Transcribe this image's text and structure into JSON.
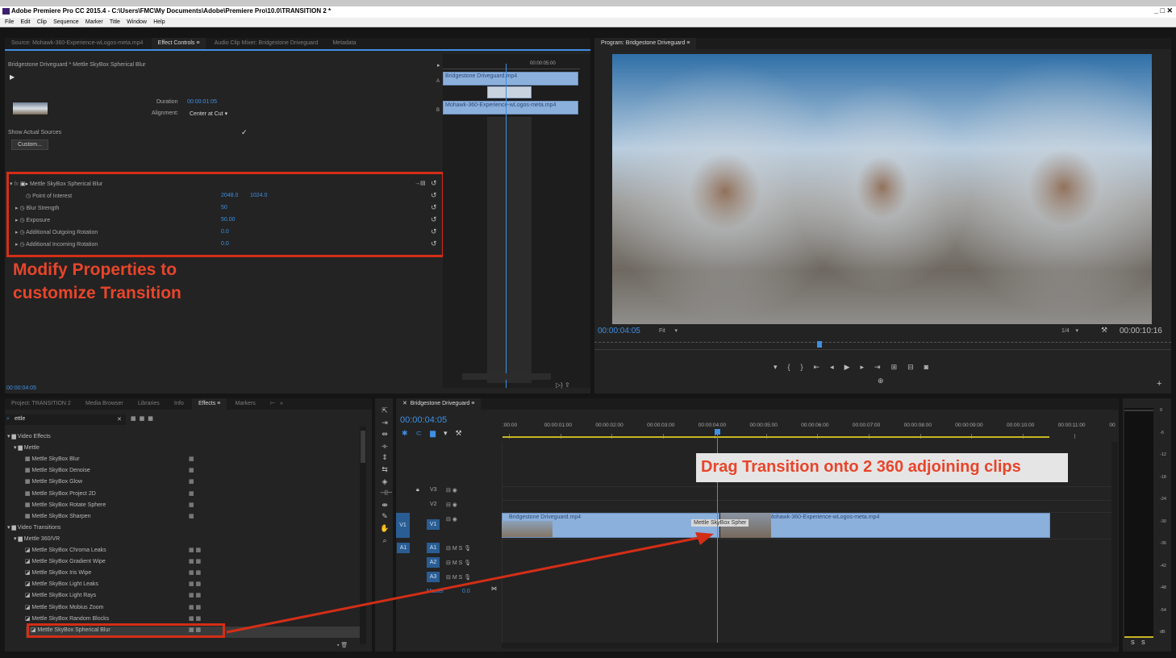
{
  "window": {
    "title": "Adobe Premiere Pro CC 2015.4 - C:\\Users\\FMC\\My Documents\\Adobe\\Premiere Pro\\10.0\\TRANSITION 2 *",
    "controls": "_ □ ✕"
  },
  "menu": [
    "File",
    "Edit",
    "Clip",
    "Sequence",
    "Marker",
    "Title",
    "Window",
    "Help"
  ],
  "source_panel": {
    "tabs": [
      "Source: Mohawk-360-Experience-wLogos-meta.mp4",
      "Effect Controls",
      "Audio Clip Mixer: Bridgestone Driveguard",
      "Metadata"
    ],
    "active_tab": "Effect Controls",
    "header": "Bridgestone Driveguard * Mettle SkyBox Spherical Blur",
    "duration_label": "Duration",
    "duration_value": "00:00:01:05",
    "alignment_label": "Alignment:",
    "alignment_value": "Center at Cut",
    "show_actual_sources": "Show Actual Sources",
    "custom_button": "Custom...",
    "effect_name": "Mettle SkyBox Spherical Blur",
    "properties": [
      {
        "name": "Point of Interest",
        "value": "2048.0",
        "value2": "1024.0"
      },
      {
        "name": "Blur Strength",
        "value": "50",
        "value2": ""
      },
      {
        "name": "Exposure",
        "value": "50.00",
        "value2": ""
      },
      {
        "name": "Additional Outgoing Rotation",
        "value": "0.0",
        "value2": ""
      },
      {
        "name": "Additional Incoming Rotation",
        "value": "0.0",
        "value2": ""
      }
    ],
    "timecode": "00:00:04:05",
    "mini_timeline": {
      "time": "00:00:05:00",
      "track_a": "A",
      "track_b": "B",
      "clip_a": "Bridgestone Driveguard.mp4",
      "clip_b": "Mohawk-360-Experience-wLogos-meta.mp4"
    }
  },
  "annotations": {
    "properties": "Modify Properties to customize Transition",
    "drag": "Drag Transition onto 2 360 adjoining clips"
  },
  "program_monitor": {
    "title": "Program: Bridgestone Driveguard",
    "timecode": "00:00:04:05",
    "fit": "Fit",
    "resolution": "1/4",
    "duration": "00:00:10:16"
  },
  "project_panel": {
    "tabs": [
      "Project: TRANSITION 2",
      "Media Browser",
      "Libraries",
      "Info",
      "Effects",
      "Markers"
    ],
    "active_tab": "Effects",
    "search_value": "ettle",
    "tree": [
      {
        "label": "Video Effects",
        "level": 0,
        "type": "folder"
      },
      {
        "label": "Mettle",
        "level": 1,
        "type": "folder"
      },
      {
        "label": "Mettle SkyBox Blur",
        "level": 2,
        "type": "fx",
        "b2": false
      },
      {
        "label": "Mettle SkyBox Denoise",
        "level": 2,
        "type": "fx",
        "b2": false
      },
      {
        "label": "Mettle SkyBox Glow",
        "level": 2,
        "type": "fx",
        "b2": false
      },
      {
        "label": "Mettle SkyBox Project 2D",
        "level": 2,
        "type": "fx",
        "b2": false
      },
      {
        "label": "Mettle SkyBox Rotate Sphere",
        "level": 2,
        "type": "fx",
        "b2": false
      },
      {
        "label": "Mettle SkyBox Sharpen",
        "level": 2,
        "type": "fx",
        "b2": false
      },
      {
        "label": "Video Transitions",
        "level": 0,
        "type": "folder"
      },
      {
        "label": "Mettle 360/VR",
        "level": 1,
        "type": "folder"
      },
      {
        "label": "Mettle SkyBox Chroma Leaks",
        "level": 2,
        "type": "tr",
        "b2": true
      },
      {
        "label": "Mettle SkyBox Gradient Wipe",
        "level": 2,
        "type": "tr",
        "b2": true
      },
      {
        "label": "Mettle SkyBox Iris Wipe",
        "level": 2,
        "type": "tr",
        "b2": true
      },
      {
        "label": "Mettle SkyBox Light Leaks",
        "level": 2,
        "type": "tr",
        "b2": true
      },
      {
        "label": "Mettle SkyBox Light Rays",
        "level": 2,
        "type": "tr",
        "b2": true
      },
      {
        "label": "Mettle SkyBox Mobius Zoom",
        "level": 2,
        "type": "tr",
        "b2": true
      },
      {
        "label": "Mettle SkyBox Random Blocks",
        "level": 2,
        "type": "tr",
        "b2": true
      },
      {
        "label": "Mettle SkyBox Spherical Blur",
        "level": 2,
        "type": "tr",
        "b2": true
      }
    ]
  },
  "timeline": {
    "title": "Bridgestone Driveguard",
    "timecode": "00:00:04:05",
    "ruler": [
      ":00:00",
      "00:00:01:00",
      "00:00:02:00",
      "00:00:03:00",
      "00:00:04:00",
      "00:00:05:00",
      "00:00:06:00",
      "00:00:07:00",
      "00:00:08:00",
      "00:00:09:00",
      "00:00:10:00",
      "00:00:11:00",
      "00"
    ],
    "tracks": {
      "v3": "V3",
      "v2": "V2",
      "v1": "V1",
      "a1": "A1",
      "a2": "A2",
      "a3": "A3",
      "master": "Master",
      "master_value": "0.0",
      "mute": "M",
      "solo": "S"
    },
    "clip1": "Bridgestone Driveguard.mp4",
    "clip2": "Mohawk-360-Experience-wLogos-meta.mp4",
    "transition": "Mettle SkyBox Spher"
  },
  "meter": {
    "scale": [
      "0",
      "-6",
      "-12",
      "-18",
      "-24",
      "-30",
      "-36",
      "-42",
      "-48",
      "-54",
      "dB"
    ],
    "footer": [
      "S",
      "S"
    ]
  },
  "colors": {
    "accent": "#3f8fe3",
    "highlight": "#d42e17",
    "clip": "#8cb0dc"
  }
}
